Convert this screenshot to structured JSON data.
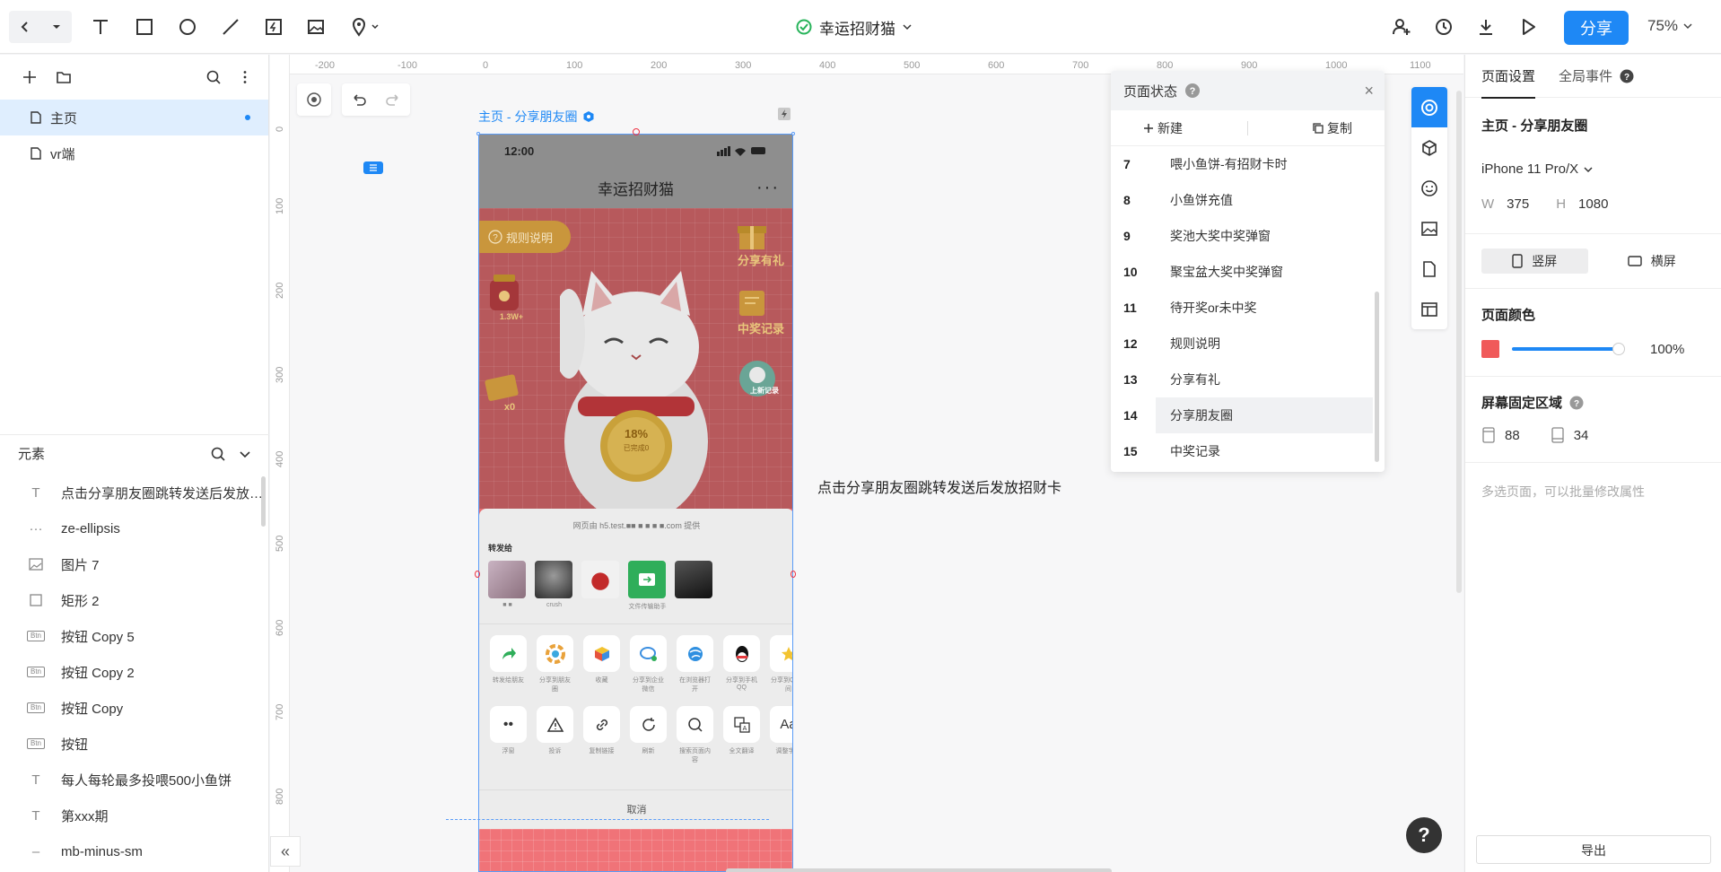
{
  "topbar": {
    "doc_title": "幸运招财猫",
    "share_label": "分享",
    "zoom_label": "75%"
  },
  "left": {
    "pages": [
      {
        "label": "主页",
        "active": true
      },
      {
        "label": "vr端",
        "active": false
      }
    ],
    "elements_title": "元素",
    "elements": [
      {
        "icon": "text",
        "label": "点击分享朋友圈跳转发送后发放招财卡"
      },
      {
        "icon": "ellipsis",
        "label": "ze-ellipsis"
      },
      {
        "icon": "image",
        "label": "图片 7"
      },
      {
        "icon": "rect",
        "label": "矩形 2"
      },
      {
        "icon": "btn",
        "label": "按钮 Copy 5"
      },
      {
        "icon": "btn",
        "label": "按钮 Copy 2"
      },
      {
        "icon": "btn",
        "label": "按钮 Copy"
      },
      {
        "icon": "btn",
        "label": "按钮"
      },
      {
        "icon": "text",
        "label": "每人每轮最多投喂500小鱼饼"
      },
      {
        "icon": "text",
        "label": "第xxx期"
      },
      {
        "icon": "minus",
        "label": "mb-minus-sm"
      }
    ]
  },
  "ruler": {
    "top": [
      "-200",
      "-100",
      "0",
      "100",
      "200",
      "300",
      "400",
      "500",
      "600",
      "700",
      "800",
      "900",
      "1000",
      "1100"
    ],
    "left": [
      "0",
      "100",
      "200",
      "300",
      "400",
      "500",
      "600",
      "700",
      "800"
    ]
  },
  "canvas": {
    "frame_label": "主页 - 分享朋友圈",
    "note": "点击分享朋友圈跳转发送后发放招财卡"
  },
  "phone": {
    "time": "12:00",
    "title": "幸运招财猫",
    "rule_btn": "规则说明",
    "side_share": "分享有礼",
    "side_record": "中奖记录",
    "side_upload": "上新记录",
    "count_left": "1.3W+",
    "count_x0": "x0",
    "progress": "18%",
    "progress_sub": "已完成0",
    "sheet_provider": "网页由 h5.test.■■ ■ ■ ■ ■.com 提供",
    "forward_to": "转发给",
    "contacts": [
      "■ ■",
      "crush",
      "",
      "文件传输助手",
      ""
    ],
    "actions1": [
      "转发给朋友",
      "分享到朋友圈",
      "收藏",
      "分享到企业微信",
      "在浏览器打开",
      "分享到手机QQ",
      "分享到QQ空间"
    ],
    "actions2": [
      "浮窗",
      "投诉",
      "复制链接",
      "刷新",
      "搜索页面内容",
      "全文翻译",
      "调整字体"
    ],
    "cancel": "取消"
  },
  "state_panel": {
    "title": "页面状态",
    "new_label": "新建",
    "copy_label": "复制",
    "rows": [
      {
        "n": "7",
        "t": "喂小鱼饼-有招财卡时"
      },
      {
        "n": "8",
        "t": "小鱼饼充值"
      },
      {
        "n": "9",
        "t": "奖池大奖中奖弹窗"
      },
      {
        "n": "10",
        "t": "聚宝盆大奖中奖弹窗"
      },
      {
        "n": "11",
        "t": "待开奖or未中奖"
      },
      {
        "n": "12",
        "t": "规则说明"
      },
      {
        "n": "13",
        "t": "分享有礼"
      },
      {
        "n": "14",
        "t": "分享朋友圈",
        "selected": true
      },
      {
        "n": "15",
        "t": "中奖记录"
      }
    ]
  },
  "right": {
    "tab_page": "页面设置",
    "tab_global": "全局事件",
    "page_title": "主页 - 分享朋友圈",
    "device": "iPhone 11 Pro/X",
    "w_label": "W",
    "w_value": "375",
    "h_label": "H",
    "h_value": "1080",
    "portrait": "竖屏",
    "landscape": "横屏",
    "color_label": "页面颜色",
    "page_color": "#f05a5a",
    "opacity": "100%",
    "fixed_label": "屏幕固定区域",
    "fixed_top": "88",
    "fixed_bottom": "34",
    "hint": "多选页面，可以批量修改属性",
    "export": "导出"
  }
}
